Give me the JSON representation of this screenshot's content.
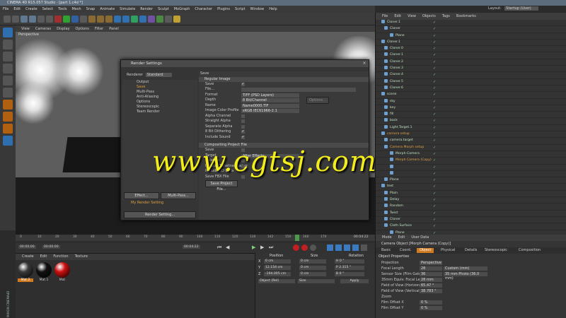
{
  "window": {
    "title": "CINEMA 4D R15.057 Studio - [part 1.c4d *]"
  },
  "menubar": [
    "File",
    "Edit",
    "Create",
    "Select",
    "Tools",
    "Mesh",
    "Snap",
    "Animate",
    "Simulate",
    "Render",
    "Sculpt",
    "MoGraph",
    "Character",
    "Plugins",
    "Script",
    "Window",
    "Help"
  ],
  "viewport": {
    "menu": [
      "View",
      "Cameras",
      "Display",
      "Options",
      "Filter",
      "Panel"
    ],
    "label": "Perspective"
  },
  "render_settings": {
    "title": "Render Settings",
    "renderer_label": "Renderer",
    "renderer_value": "Standard",
    "nav": [
      "Output",
      "Save",
      "Multi-Pass",
      "Anti-Aliasing",
      "Options",
      "Stereoscopic",
      "Team Render"
    ],
    "nav_selected": "Save",
    "effect_button": "Effect...",
    "multipass_button": "Multi-Pass...",
    "preset_name": "My Render Setting",
    "render_setting_button": "Render Setting...",
    "panel_title": "Save",
    "regular_image_header": "Regular Image",
    "rows": [
      {
        "label": "Save",
        "value": "✓",
        "type": "check"
      },
      {
        "label": "File...",
        "value": "",
        "type": "field"
      },
      {
        "label": "Format",
        "value": "TIFF (PSD Layers)",
        "type": "field"
      },
      {
        "label": "Depth",
        "value": "8 Bit/Channel",
        "type": "field"
      },
      {
        "label": "Name",
        "value": "Name0000.TIF",
        "type": "field"
      },
      {
        "label": "Image Color Profile",
        "value": "sRGB IEC61966-2.1",
        "type": "field"
      },
      {
        "label": "Alpha Channel",
        "value": "",
        "type": "check"
      },
      {
        "label": "Straight Alpha",
        "value": "",
        "type": "check"
      },
      {
        "label": "Separate Alpha",
        "value": "",
        "type": "check"
      },
      {
        "label": "8 Bit Dithering",
        "value": "✓",
        "type": "check"
      },
      {
        "label": "Include Sound",
        "value": "✓",
        "type": "check"
      }
    ],
    "options_button": "Options...",
    "compositing_header": "Compositing Project File",
    "comp_rows": [
      "Save",
      "Target",
      "Relative",
      "Include Timeline Marker",
      "Include 3D Data",
      "Save FBX File"
    ],
    "comp_target_value": "After Effects",
    "save_project_button": "Save Project File..."
  },
  "watermark": "www.cgtsj.com",
  "object_manager": {
    "menu": [
      "File",
      "Edit",
      "View",
      "Objects",
      "Tags",
      "Bookmarks"
    ],
    "objects": [
      {
        "name": "Cloner.1",
        "hl": false
      },
      {
        "name": "Cloner",
        "hl": false
      },
      {
        "name": "Plane",
        "hl": false
      },
      {
        "name": "Cloner.1",
        "hl": false
      },
      {
        "name": "Cloner.0",
        "hl": false
      },
      {
        "name": "Cloner.1",
        "hl": false
      },
      {
        "name": "Cloner.2",
        "hl": false
      },
      {
        "name": "Cloner.3",
        "hl": false
      },
      {
        "name": "Cloner.4",
        "hl": false
      },
      {
        "name": "Cloner.5",
        "hl": false
      },
      {
        "name": "Cloner.6",
        "hl": false
      },
      {
        "name": "scene",
        "hl": false
      },
      {
        "name": "sky",
        "hl": false
      },
      {
        "name": "key",
        "hl": false
      },
      {
        "name": "fill",
        "hl": false
      },
      {
        "name": "back",
        "hl": false
      },
      {
        "name": "Light.Target.1",
        "hl": false
      },
      {
        "name": "camera setup",
        "hl": true
      },
      {
        "name": "camera.target",
        "hl": false
      },
      {
        "name": "Camera Morph setup",
        "hl": true
      },
      {
        "name": "Morph Camera",
        "hl": false
      },
      {
        "name": "Morph Camera (Copy)",
        "hl": true
      },
      {
        "name": "",
        "hl": false
      },
      {
        "name": "",
        "hl": false
      },
      {
        "name": "Plane",
        "hl": false
      },
      {
        "name": "text",
        "hl": false
      },
      {
        "name": "Plain",
        "hl": false
      },
      {
        "name": "Delay",
        "hl": false
      },
      {
        "name": "Random",
        "hl": false
      },
      {
        "name": "Twist",
        "hl": false
      },
      {
        "name": "Cloner",
        "hl": false
      },
      {
        "name": "Cloth Surface",
        "hl": false
      },
      {
        "name": "Plane",
        "hl": false
      },
      {
        "name": "Poly.t",
        "hl": false
      }
    ]
  },
  "attributes": {
    "menu": [
      "Mode",
      "Edit",
      "User Data"
    ],
    "object_title": "Camera Object [Morph Camera (Copy)]",
    "tabs": [
      "Basic",
      "Coord.",
      "Object",
      "Physical",
      "Details",
      "Stereoscopic",
      "Composition"
    ],
    "active_tab": "Object",
    "section": "Object Properties",
    "rows": [
      {
        "label": "Projection",
        "v1": "Perspective",
        "v2": ""
      },
      {
        "label": "Focal Length",
        "v1": "28",
        "v2": "Custom (mm)"
      },
      {
        "label": "Sensor Size (Film Gate)",
        "v1": "36",
        "v2": "35 mm Photo (36.0 mm)"
      },
      {
        "label": "35mm Equiv. Focal Length:",
        "v1": "28 mm",
        "v2": ""
      },
      {
        "label": "Field of View (Horizontal)",
        "v1": "65.47 °",
        "v2": ""
      },
      {
        "label": "Field of View (Vertical)",
        "v1": "38.783 °",
        "v2": ""
      },
      {
        "label": "Zoom",
        "v1": "",
        "v2": ""
      },
      {
        "label": "Film Offset X",
        "v1": "0 %",
        "v2": ""
      },
      {
        "label": "Film Offset Y",
        "v1": "0 %",
        "v2": ""
      }
    ]
  },
  "timeline": {
    "ticks": [
      "0",
      "10",
      "20",
      "30",
      "40",
      "50",
      "60",
      "70",
      "80",
      "90",
      "100",
      "110",
      "120",
      "130",
      "142",
      "150",
      "160",
      "170"
    ],
    "current": "142",
    "start": "00:00:00",
    "end": "00:04:22",
    "end2": "00:04:22"
  },
  "materials": {
    "menu": [
      "Create",
      "Edit",
      "Function",
      "Texture"
    ],
    "items": [
      {
        "name": "Mat.2",
        "color": "#3a3a3a"
      },
      {
        "name": "Mat.1",
        "color": "#111111"
      },
      {
        "name": "Mat",
        "color": "#cc1010"
      }
    ]
  },
  "coordinates": {
    "headers": [
      "Position",
      "Size",
      "Rotation"
    ],
    "rows": [
      {
        "axis": "X",
        "pos": "0 cm",
        "size": "0 cm",
        "rot": "H  0 °"
      },
      {
        "axis": "Y",
        "pos": "12.154 cm",
        "size": "0 cm",
        "rot": "P  2.315 °"
      },
      {
        "axis": "Z",
        "pos": "-194.005 cm",
        "size": "0 cm",
        "rot": "B  0 °"
      }
    ],
    "mode1": "Object (Rel)",
    "mode2": "Size",
    "apply": "Apply"
  },
  "layout": {
    "label": "Layout:",
    "value": "Startup (User)"
  },
  "logo": "MAXON CINEMA4D"
}
